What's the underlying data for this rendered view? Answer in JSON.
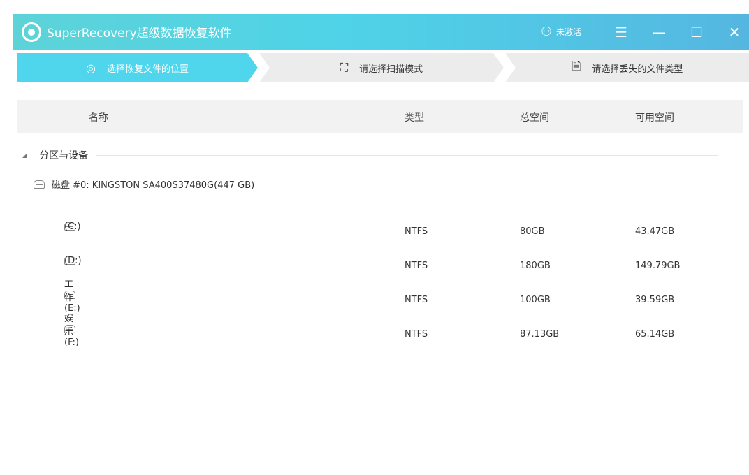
{
  "app": {
    "title": "SuperRecovery超级数据恢复软件",
    "user_status": "未激活"
  },
  "steps": [
    {
      "label": "选择恢复文件的位置",
      "active": true
    },
    {
      "label": "请选择扫描模式",
      "active": false
    },
    {
      "label": "请选择丢失的文件类型",
      "active": false
    }
  ],
  "table": {
    "headers": [
      "名称",
      "类型",
      "总空间",
      "可用空间"
    ],
    "group": "分区与设备",
    "disk": "磁盘 #0: KINGSTON SA400S37480G(447 GB)",
    "rows": [
      {
        "name": "(C:)",
        "type": "NTFS",
        "total": "80GB",
        "free": "43.47GB"
      },
      {
        "name": "(D:)",
        "type": "NTFS",
        "total": "180GB",
        "free": "149.79GB"
      },
      {
        "name": "工作(E:)",
        "type": "NTFS",
        "total": "100GB",
        "free": "39.59GB"
      },
      {
        "name": "娱乐(F:)",
        "type": "NTFS",
        "total": "87.13GB",
        "free": "65.14GB"
      }
    ]
  },
  "colors": {
    "accent": "#4fd5ec",
    "titlebar_start": "#5dd3d8",
    "titlebar_end": "#55b6e0"
  }
}
